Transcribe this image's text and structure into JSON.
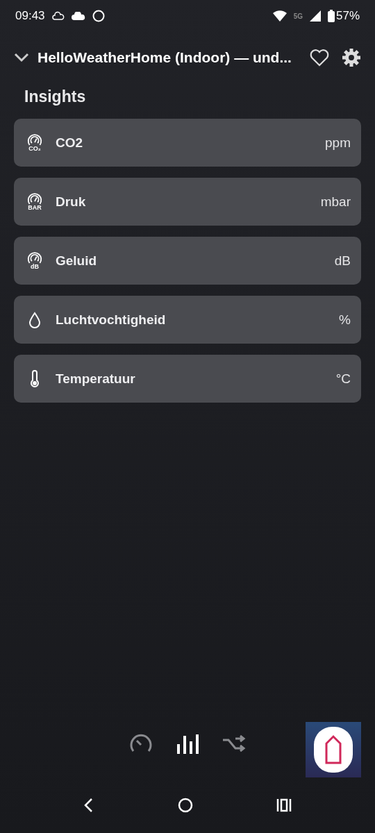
{
  "status_bar": {
    "time": "09:43",
    "network": "5G",
    "battery": "57%"
  },
  "header": {
    "title": "HelloWeatherHome (Indoor) — und..."
  },
  "section": {
    "title": "Insights"
  },
  "items": [
    {
      "kind": "gauge",
      "icon_label": "CO₂",
      "name": "CO2",
      "unit": "ppm"
    },
    {
      "kind": "gauge",
      "icon_label": "BAR",
      "name": "Druk",
      "unit": "mbar"
    },
    {
      "kind": "gauge",
      "icon_label": "dB",
      "name": "Geluid",
      "unit": "dB"
    },
    {
      "kind": "drop",
      "name": "Luchtvochtigheid",
      "unit": "%"
    },
    {
      "kind": "thermometer",
      "name": "Temperatuur",
      "unit": "°C"
    }
  ],
  "bottom_tabs": [
    {
      "kind": "gauge",
      "selected": false
    },
    {
      "kind": "bars",
      "selected": true
    },
    {
      "kind": "shuffle",
      "selected": false
    }
  ]
}
